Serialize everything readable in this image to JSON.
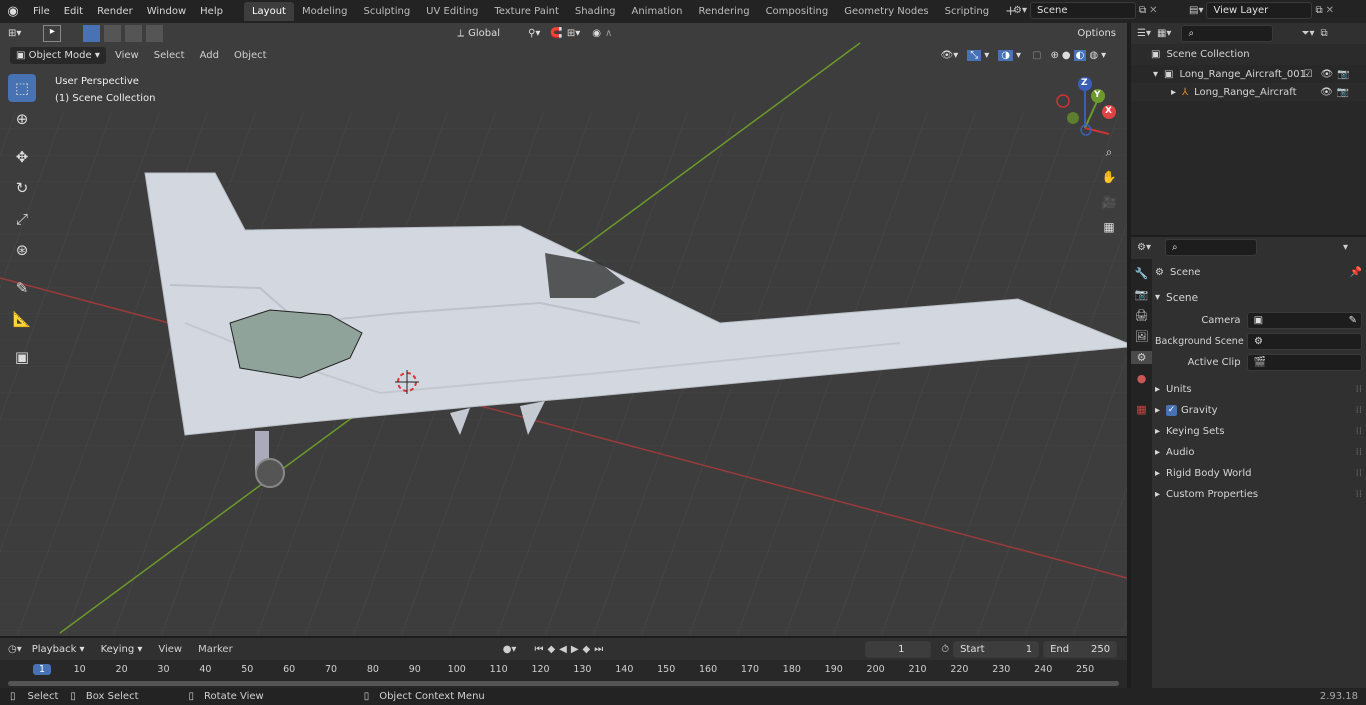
{
  "menu": [
    "File",
    "Edit",
    "Render",
    "Window",
    "Help"
  ],
  "workspaces": [
    "Layout",
    "Modeling",
    "Sculpting",
    "UV Editing",
    "Texture Paint",
    "Shading",
    "Animation",
    "Rendering",
    "Compositing",
    "Geometry Nodes",
    "Scripting"
  ],
  "active_workspace": "Layout",
  "scene_field": "Scene",
  "view_layer_field": "View Layer",
  "viewport": {
    "mode": "Object Mode",
    "menus": [
      "View",
      "Select",
      "Add",
      "Object"
    ],
    "orientation": "Global",
    "options_label": "Options",
    "overlay_title": "User Perspective",
    "overlay_sub": "(1) Scene Collection",
    "gizmo": {
      "x": "X",
      "y": "Y",
      "z": "Z"
    }
  },
  "outliner": {
    "root": "Scene Collection",
    "items": [
      {
        "label": "Long_Range_Aircraft_001"
      },
      {
        "label": "Long_Range_Aircraft"
      }
    ]
  },
  "properties": {
    "header": "Scene",
    "section": "Scene",
    "fields": [
      {
        "label": "Camera",
        "value": ""
      },
      {
        "label": "Background Scene",
        "value": ""
      },
      {
        "label": "Active Clip",
        "value": ""
      }
    ],
    "panels": [
      "Units",
      "Gravity",
      "Keying Sets",
      "Audio",
      "Rigid Body World",
      "Custom Properties"
    ]
  },
  "timeline": {
    "menus": [
      "Playback",
      "Keying",
      "View",
      "Marker"
    ],
    "current_frame": "1",
    "start_label": "Start",
    "start": "1",
    "end_label": "End",
    "end": "250",
    "ruler": [
      "1",
      "10",
      "20",
      "30",
      "40",
      "50",
      "60",
      "70",
      "80",
      "90",
      "100",
      "110",
      "120",
      "130",
      "140",
      "150",
      "160",
      "170",
      "180",
      "190",
      "200",
      "210",
      "220",
      "230",
      "240",
      "250"
    ]
  },
  "statusbar": {
    "items": [
      "Select",
      "Box Select",
      "Rotate View",
      "Object Context Menu"
    ],
    "version": "2.93.18"
  },
  "colors": {
    "accent": "#4772b3",
    "x_axis": "#9b3a3a",
    "y_axis": "#6b9a2a",
    "active_outline": "#e08a2e"
  }
}
